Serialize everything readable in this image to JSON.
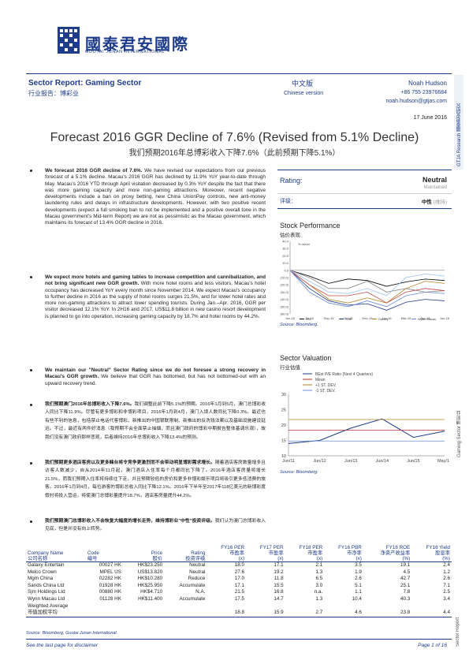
{
  "logo": {
    "name_cn": "國泰君安國際",
    "name_en": "GUOTAI JUNAN INTERNATIONAL"
  },
  "sidebar": {
    "top": "GTJA Research 國泰君安研究",
    "middle": "Gaming Sector 博彩业",
    "bottom": "Sector Report"
  },
  "header": {
    "title": "Sector Report: Gaming Sector",
    "title_cn": "行业报告：博彩业",
    "lang_cn": "中文版",
    "lang_en": "Chinese version",
    "analyst_name": "Noah Hudson",
    "analyst_phone": "+86 755 23976684",
    "analyst_email": "noah.hudson@gtjas.com",
    "date": "17 June 2016"
  },
  "headline": {
    "en": "Forecast 2016 GGR Decline of 7.6% (Revised from 5.1% Decline)",
    "cn": "我们预期2016年总博彩收入下降7.6%（此前预期下降5.1%）"
  },
  "body": {
    "p1_bold": "We forecast 2016 GGR decline of 7.6%.",
    "p1_text": " We have revised our expectations from our previous forecast of a 5.1% decline. Macau's 2016 GGR has declined by 11.9% YoY year-to-date through May. Macau's 2016 YTD through April visitation decreased by 0.3% YoY despite the fact that there was more gaming capacity and more non-gaming attractions. Moreover, recent negative developments include a ban on proxy betting, new China UnionPay controls, new anti-money laundering rules and delays in infrastructure developments. However, with two positive recent developments (expect a full smoking ban to not be implemented and a positive overall tone in the Macau government's Mid-term Report) we are not as pessimistic as the Macau government, which maintains its forecast of 13.4% GGR decline in 2016.",
    "p2_bold": "We expect more hotels and gaming tables to increase competition and cannibalization, and not bring significant new GGR growth.",
    "p2_text": " With more hotel rooms and less visitors, Macau's hotel occupancy has decreased YoY every month since November 2014. We expect Macau's occupancy to further decline in 2016 as the supply of hotel rooms surges 21.5%, and for lower hotel rates and more non-gaming attractions to attract lower spending tourists. During Jan.–Apr. 2016, GGR per visitor decreased 12.1% YoY. In 2H16 and 2017, US$11.8 billion in new casino resort development is planned to go into operation, increasing gaming capacity by 18.7% and hotel rooms by 44.2%.",
    "p3_bold": "We maintain our \"Neutral\" Sector Rating since we do not foresee a strong recovery in Macau's GGR growth.",
    "p3_text": " We believe that GGR has bottomed, but has not bottomed-out with an upward recovery trend.",
    "c1_bold": "我们预期澳门2016年总博彩收入下降7.6%。",
    "c1_text": "我们调整此前下降5.1%的预期。2016年1月到5月，澳门总博彩收入同比下降11.9%。尽管有更多博彩和非博彩项目，2016年1月到4月，澳门入境人数同比下降0.3%。最近也有些不利的信息，包括禁止电话代客博彩、新推出的中国银联限制、新推出的反洗钱法案以及基础设施建设延迟。不过，最近有两件好消息（我预期不会全面禁止抽烟，而且澳门政府的博彩中期报告整体基调乐观），故我们没有澳门政府那样悲观，后者维持2016年总博彩收入下降13.4%的预测。",
    "c2_bold": "我们预期更多酒店客房以及更多赌台将令竞争更激烈而不会带动明显博彩需求增长。",
    "c2_text": "随着酒店客房数量增多且访客人数减少，自从2014年11月起，澳门酒店入住率每个月都同比下降了。2016年酒店客房量将增长21.5%，而我们预期入住率将持续往下走，并且预期较低的房价和更多非博彩娱乐项目将吸引更多低消费的旅客。2016年1月到4月，每位游客的博彩总收入同比下降12.1%。2016年下半年至2017年118亿美元的新博彩度假村将投入营运，将使澳门总博彩量提升18.7%，酒店客房量提升44.2%。",
    "c3_bold": "我们预期澳门总博彩收入不会恢复大幅度的增长走势，维持博彩业\"中性\"投资评级。",
    "c3_text": "我们认为澳门总博彩收入见底，但是并没有向上转势。"
  },
  "rating": {
    "label": "Rating:",
    "value": "Neutral",
    "sub": "Maintained",
    "label_cn": "评级：",
    "value_cn": "中性",
    "sub_cn": "(维持)"
  },
  "stock_perf": {
    "title": "Stock Performance",
    "title_cn": "估价表现",
    "source": "Source: Bloomberg.",
    "chart_data": {
      "type": "line",
      "ylabel": "% return",
      "ylim": [
        -60,
        40
      ],
      "yticks": [
        "40.0",
        "30.0",
        "20.0",
        "10.0",
        "0.0",
        "(10.0)",
        "(20.0)",
        "(30.0)",
        "(40.0)",
        "(50.0)",
        "(60.0)"
      ],
      "x": [
        "Jun-15",
        "Jul-15",
        "Sep-15",
        "Oct-15",
        "Dec-15",
        "Jan-16",
        "Mar-16",
        "Apr-16",
        "Jun-16"
      ],
      "series": [
        {
          "name": "HSI",
          "color": "#000000",
          "values": [
            0,
            -8,
            -18,
            -12,
            -14,
            -22,
            -16,
            -12,
            -14
          ]
        },
        {
          "name": "SJM",
          "color": "#1f3c8a",
          "values": [
            0,
            -25,
            -42,
            -48,
            -46,
            -55,
            -44,
            -40,
            -42
          ]
        },
        {
          "name": "Galaxy",
          "color": "#b08020",
          "values": [
            0,
            -20,
            -40,
            -45,
            -38,
            -45,
            -25,
            -15,
            -18
          ]
        },
        {
          "name": "Wynn Macau",
          "color": "#6a8ad8",
          "values": [
            0,
            -30,
            -45,
            -50,
            -42,
            -50,
            -35,
            -30,
            -32
          ]
        },
        {
          "name": "Melco Crown",
          "color": "#888888",
          "values": [
            0,
            -10,
            -25,
            -25,
            -15,
            -30,
            -25,
            -30,
            -28
          ]
        },
        {
          "name": "MGM China",
          "color": "#c24a4a",
          "values": [
            0,
            -20,
            -35,
            -35,
            -30,
            -45,
            -30,
            -25,
            -28
          ]
        },
        {
          "name": "Sands",
          "color": "#9ac0ea",
          "values": [
            0,
            -15,
            -30,
            -32,
            -25,
            -35,
            -10,
            -5,
            -8
          ]
        }
      ]
    }
  },
  "valuation": {
    "title": "Sector Valuation",
    "title_cn": "行业估值",
    "source": "Source: Bloomberg.",
    "chart_data": {
      "type": "line",
      "ylim": [
        10,
        30
      ],
      "yticks": [
        "30",
        "25",
        "20",
        "15",
        "10"
      ],
      "x": [
        "Jun/11",
        "Jun/12",
        "Jun/13",
        "Jun/14",
        "Jun/15",
        "May/16"
      ],
      "series": [
        {
          "name": "BEst P/E Ratio (Next 4 Quarters)",
          "color": "#1f3c8a",
          "values": [
            14,
            15,
            19,
            22,
            16,
            18
          ]
        },
        {
          "name": "Mean",
          "color": "#b03030",
          "values": [
            18.3,
            18.3,
            18.3,
            18.3,
            18.3,
            18.3
          ]
        },
        {
          "name": "+1 ST. DEV.",
          "color": "#b08020",
          "values": [
            21.8,
            21.8,
            21.8,
            21.8,
            21.8,
            21.8
          ]
        },
        {
          "name": "-1 ST. DEV.",
          "color": "#6a8ad8",
          "values": [
            14.8,
            14.8,
            14.8,
            14.8,
            14.8,
            14.8
          ]
        }
      ]
    }
  },
  "table": {
    "headers": [
      [
        "Company Name",
        "公司名称"
      ],
      [
        "Code",
        "编号"
      ],
      [
        "Price",
        "股价"
      ],
      [
        "Rating",
        "投资评级"
      ],
      [
        "FY16 PER",
        "市盈率",
        "(x)"
      ],
      [
        "FY17 PER",
        "市盈率",
        "(x)"
      ],
      [
        "FY18 PER",
        "市盈率",
        "(x)"
      ],
      [
        "FY16 PBR",
        "市净率",
        "(x)"
      ],
      [
        "FY16 ROE",
        "净资产收益率",
        "(%)"
      ],
      [
        "FY16 Yield",
        "股息率",
        "(%)"
      ]
    ],
    "rows": [
      [
        "Galaxy Entertain",
        "00027 HK",
        "HK$23.250",
        "Neutral",
        "18.0",
        "17.1",
        "2.1",
        "3.5",
        "19.1",
        "2.4"
      ],
      [
        "Melco Crown",
        "MPEL US",
        "US$13.820",
        "Neutral",
        "27.6",
        "19.2",
        "1.3",
        "1.9",
        "4.5",
        "1.2"
      ],
      [
        "Mgm China",
        "02282 HK",
        "HK$10.280",
        "Reduce",
        "17.0",
        "11.8",
        "6.5",
        "2.6",
        "42.7",
        "2.6"
      ],
      [
        "Sands China Ltd",
        "01928 HK",
        "HK$25.950",
        "Accumulate",
        "17.1",
        "15.5",
        "3.0",
        "5.1",
        "25.1",
        "7.1"
      ],
      [
        "Sjm Holdings Ltd",
        "00880 HK",
        "HK$4.710",
        "N.A.",
        "21.5",
        "16.8",
        "n.a.",
        "1.1",
        "7.8",
        "2.5"
      ],
      [
        "Wynn Macau Ltd",
        "01128 HK",
        "HK$11.400",
        "Accumulate",
        "17.5",
        "14.7",
        "1.3",
        "10.4",
        "40.3",
        "3.4"
      ]
    ],
    "avg_label": "Weighted Average",
    "avg_label_cn": "市值加权平均",
    "avg_values": [
      "18.8",
      "15.9",
      "2.7",
      "4.6",
      "23.8",
      "4.4"
    ],
    "source": "Source: Bloomberg, Guotai Junan International."
  },
  "footer": {
    "disclaimer": "See the last page for disclaimer",
    "page": "Page 1 of 16"
  }
}
